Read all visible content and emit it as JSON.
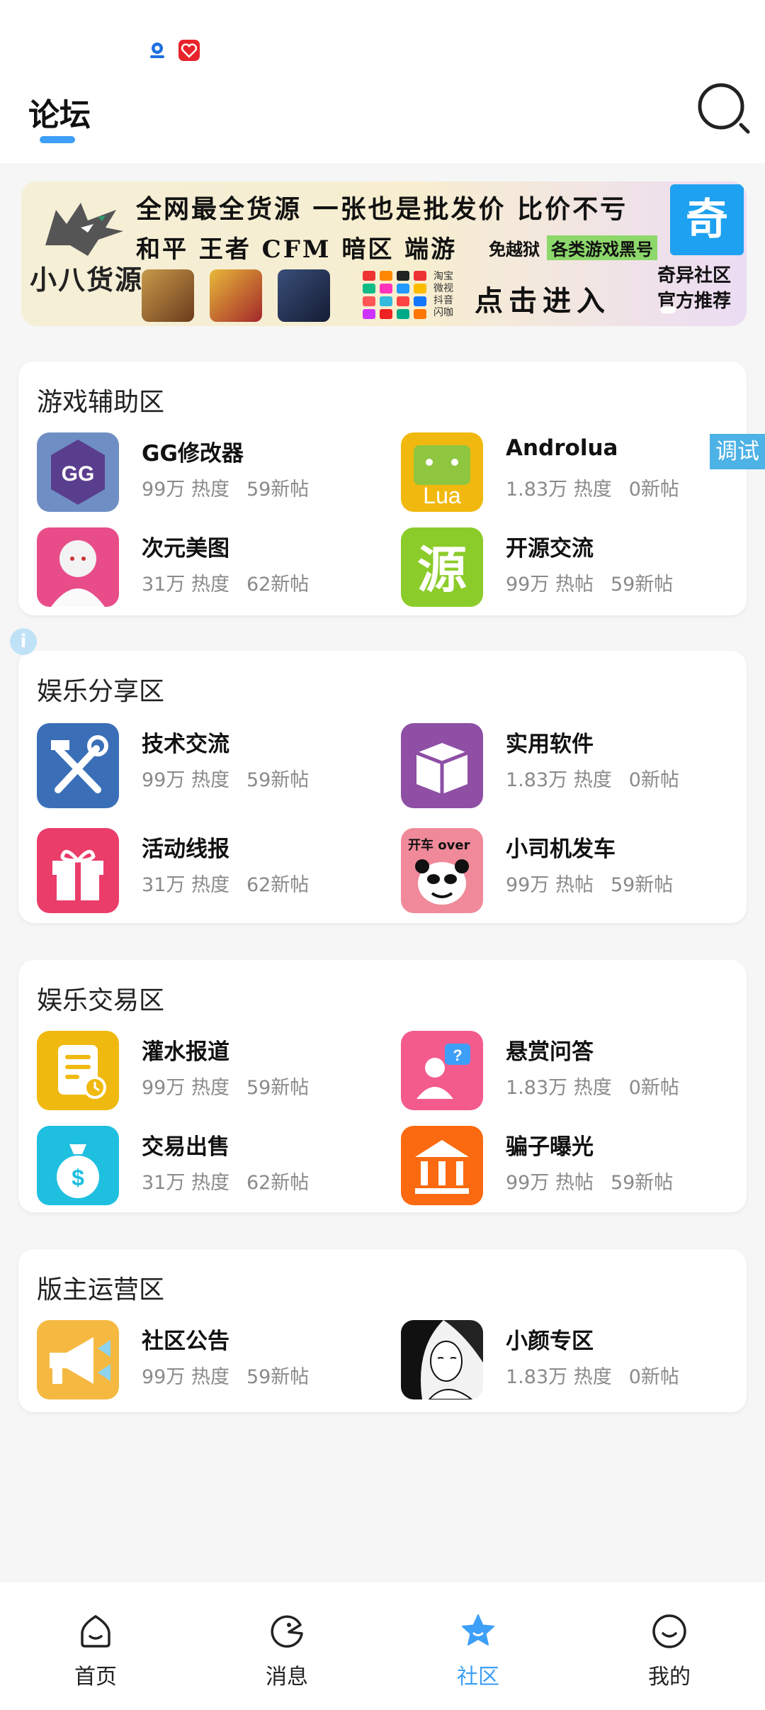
{
  "colors": {
    "accent": "#3d9ff7",
    "card_bg": "#ffffff",
    "page_bg": "#f6f6f6",
    "muted_text": "#8a8a8a",
    "debug_tab": "#4db2e6"
  },
  "header": {
    "title": "论坛",
    "search_icon": "search-icon"
  },
  "banner": {
    "brand": "小八货源",
    "line1": "全网最全货源 一张也是批发价 比价不亏",
    "line2": "和平 王者 CFM 暗区 端游",
    "line2_small": "免越狱",
    "tag": "各类游戏黑号",
    "cta": "点击进入",
    "badge": "奇",
    "sub1": "奇异社区",
    "sub2": "官方推荐",
    "apps": [
      "淘宝",
      "微视",
      "抖音",
      "闪咖"
    ]
  },
  "debug_tab": "调试",
  "sections": [
    {
      "title": "游戏辅助区",
      "items": [
        {
          "name": "GG修改器",
          "heat": "99万 热度",
          "posts": "59新帖",
          "icon": "gg-icon"
        },
        {
          "name": "Androlua",
          "heat": "1.83万 热度",
          "posts": "0新帖",
          "icon": "androlua-icon"
        },
        {
          "name": "次元美图",
          "heat": "31万 热度",
          "posts": "62新帖",
          "icon": "anime-art-icon"
        },
        {
          "name": "开源交流",
          "heat": "99万 热帖",
          "posts": "59新帖",
          "icon": "open-source-icon"
        }
      ]
    },
    {
      "title": "娱乐分享区",
      "items": [
        {
          "name": "技术交流",
          "heat": "99万 热度",
          "posts": "59新帖",
          "icon": "tools-icon"
        },
        {
          "name": "实用软件",
          "heat": "1.83万 热度",
          "posts": "0新帖",
          "icon": "box-icon"
        },
        {
          "name": "活动线报",
          "heat": "31万 热度",
          "posts": "62新帖",
          "icon": "gift-icon"
        },
        {
          "name": "小司机发车",
          "heat": "99万 热帖",
          "posts": "59新帖",
          "icon": "panda-meme-icon",
          "icon_text": "开车 over"
        }
      ]
    },
    {
      "title": "娱乐交易区",
      "items": [
        {
          "name": "灌水报道",
          "heat": "99万 热度",
          "posts": "59新帖",
          "icon": "document-clock-icon"
        },
        {
          "name": "悬赏问答",
          "heat": "1.83万 热度",
          "posts": "0新帖",
          "icon": "user-question-icon"
        },
        {
          "name": "交易出售",
          "heat": "31万 热度",
          "posts": "62新帖",
          "icon": "money-bag-icon"
        },
        {
          "name": "骗子曝光",
          "heat": "99万 热帖",
          "posts": "59新帖",
          "icon": "bank-icon"
        }
      ]
    },
    {
      "title": "版主运营区",
      "items": [
        {
          "name": "社区公告",
          "heat": "99万 热度",
          "posts": "59新帖",
          "icon": "megaphone-icon"
        },
        {
          "name": "小颜专区",
          "heat": "1.83万 热度",
          "posts": "0新帖",
          "icon": "anime-girl-icon"
        }
      ]
    }
  ],
  "tabbar": [
    {
      "label": "首页",
      "icon": "home-icon",
      "active": false
    },
    {
      "label": "消息",
      "icon": "message-icon",
      "active": false
    },
    {
      "label": "社区",
      "icon": "star-icon",
      "active": true
    },
    {
      "label": "我的",
      "icon": "smile-icon",
      "active": false
    }
  ]
}
